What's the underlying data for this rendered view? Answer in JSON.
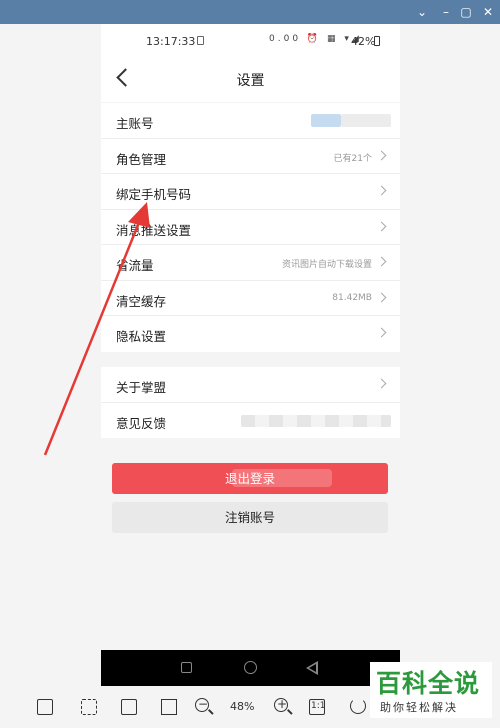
{
  "status_bar": {
    "time": "13:17:33",
    "icons": "0.00 ⏰ ▦ ▾◢",
    "battery": "42%"
  },
  "nav": {
    "title": "设置"
  },
  "settings_group_1": [
    {
      "label": "主账号",
      "value": ""
    },
    {
      "label": "角色管理",
      "value": "已有21个"
    },
    {
      "label": "绑定手机号码",
      "value": ""
    },
    {
      "label": "消息推送设置",
      "value": ""
    },
    {
      "label": "省流量",
      "value": "资讯图片自动下载设置"
    },
    {
      "label": "清空缓存",
      "value": "81.42MB"
    },
    {
      "label": "隐私设置",
      "value": ""
    }
  ],
  "settings_group_2": [
    {
      "label": "关于掌盟",
      "value": ""
    },
    {
      "label": "意见反馈",
      "value": ""
    }
  ],
  "buttons": {
    "logout": "退出登录",
    "cancel_account": "注销账号"
  },
  "toolbar": {
    "zoom": "48%",
    "actual_size": "1:1"
  },
  "watermark": {
    "title": "百科全说",
    "subtitle": "助你轻松解决"
  },
  "colors": {
    "accent_red": "#f04f55",
    "titlebar": "#5a7fa6",
    "annotation_arrow": "#e53935",
    "watermark_green": "#2c9a3c"
  }
}
